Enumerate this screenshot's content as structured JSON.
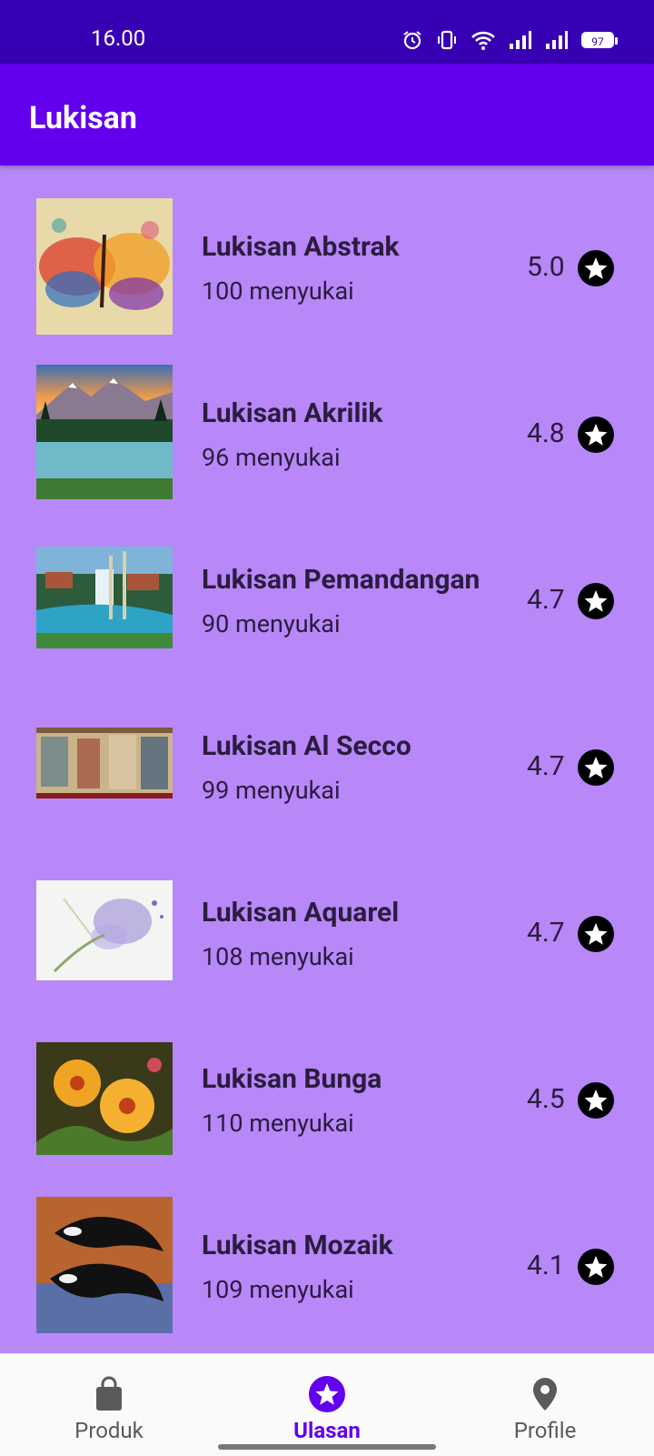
{
  "status_bar": {
    "time": "16.00",
    "battery": "97",
    "icons": [
      "alarm-icon",
      "vibrate-icon",
      "wifi-icon",
      "signal-icon",
      "signal-icon",
      "battery-icon"
    ]
  },
  "app_bar": {
    "title": "Lukisan"
  },
  "items": [
    {
      "name": "Lukisan Abstrak",
      "likes": "100 menyukai",
      "rating": "5.0",
      "image": "abstract-butterfly-painting"
    },
    {
      "name": "Lukisan Akrilik",
      "likes": "96 menyukai",
      "rating": "4.8",
      "image": "mountain-lake-painting"
    },
    {
      "name": "Lukisan Pemandangan",
      "likes": "90 menyukai",
      "rating": "4.7",
      "image": "waterfall-landscape-painting"
    },
    {
      "name": "Lukisan Al Secco",
      "likes": "99 menyukai",
      "rating": "4.7",
      "image": "fresco-mural-painting"
    },
    {
      "name": "Lukisan Aquarel",
      "likes": "108 menyukai",
      "rating": "4.7",
      "image": "watercolor-butterfly-painting"
    },
    {
      "name": "Lukisan Bunga",
      "likes": "110 menyukai",
      "rating": "4.5",
      "image": "flower-painting"
    },
    {
      "name": "Lukisan Mozaik",
      "likes": "109 menyukai",
      "rating": "4.1",
      "image": "orca-mosaic"
    }
  ],
  "bottom_nav": [
    {
      "label": "Produk",
      "icon": "shopping-bag-icon",
      "active": false
    },
    {
      "label": "Ulasan",
      "icon": "star-icon",
      "active": true
    },
    {
      "label": "Profile",
      "icon": "location-pin-icon",
      "active": false
    }
  ],
  "colors": {
    "status_bar": "#3700b3",
    "app_bar": "#6200ee",
    "list_background": "#b887f8",
    "accent": "#6200ee"
  }
}
